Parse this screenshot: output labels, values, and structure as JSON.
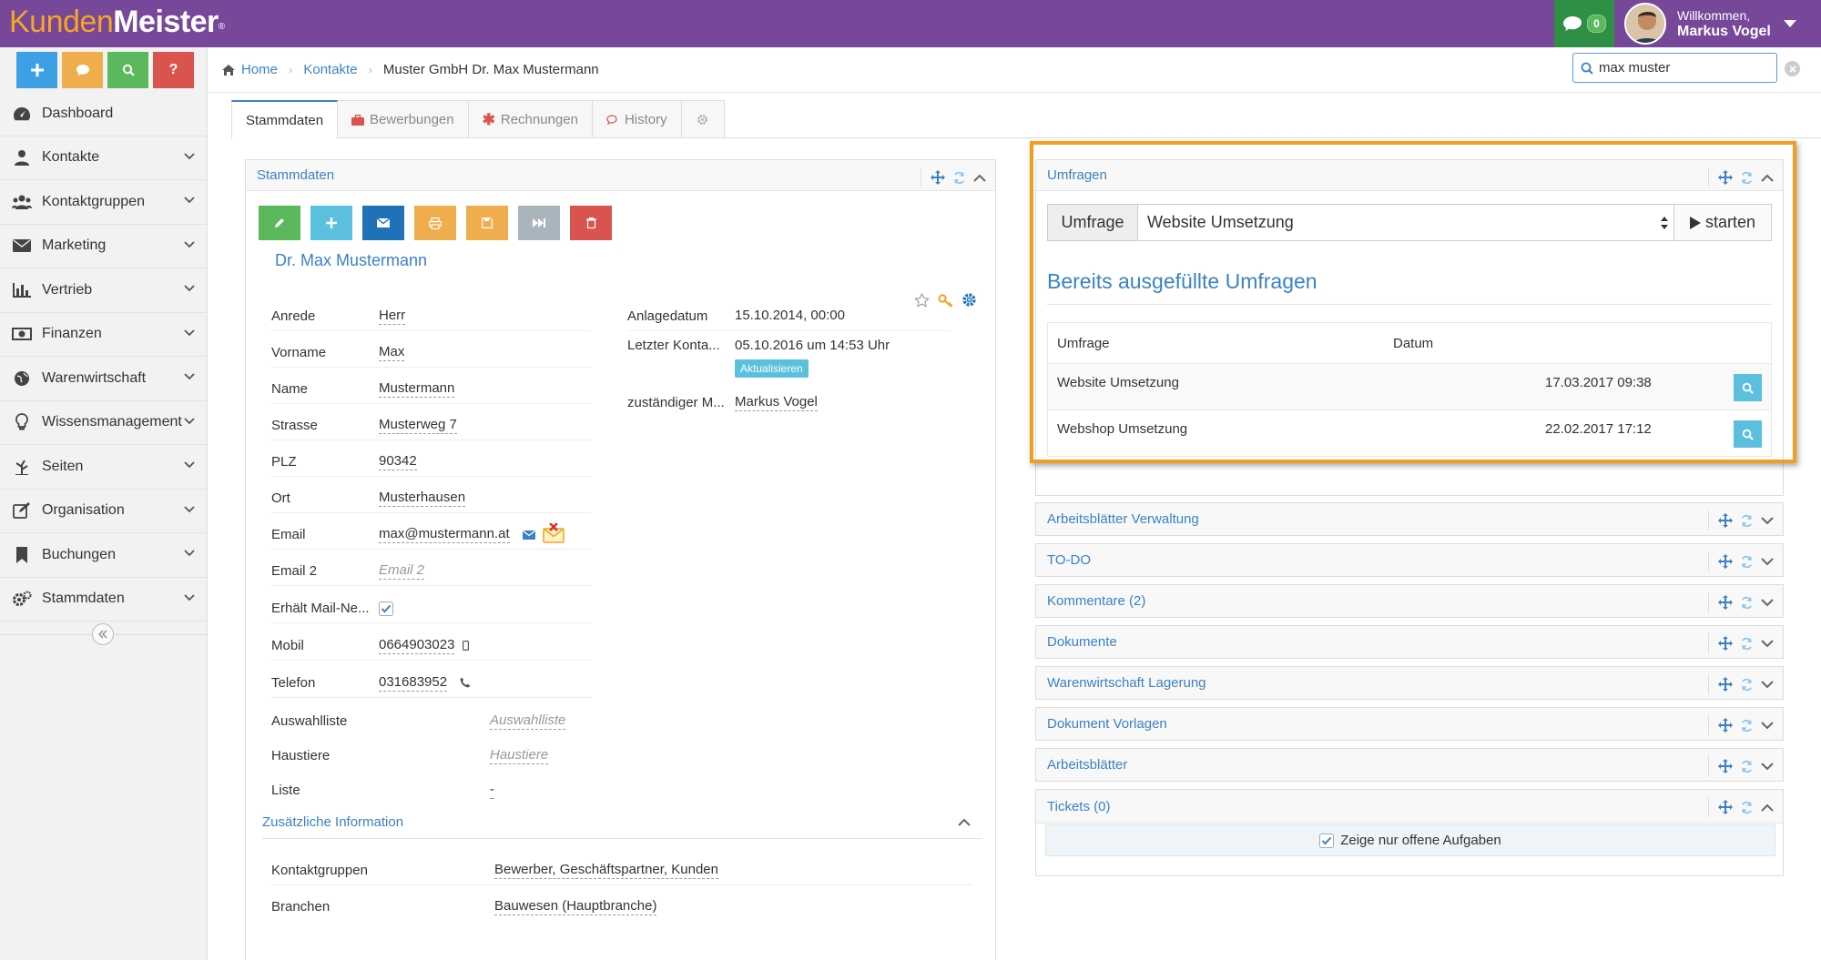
{
  "app": {
    "logo_part1": "Kunden",
    "logo_part2": "Meister",
    "logo_mark": "®",
    "chat_count": "0",
    "user_greeting": "Willkommen,",
    "user_name": "Markus Vogel"
  },
  "quick_buttons": [
    {
      "icon": "plus-icon",
      "color": "#3ea0e4"
    },
    {
      "icon": "chat-icon",
      "color": "#f0ad4e"
    },
    {
      "icon": "search-icon",
      "color": "#5cb85c"
    },
    {
      "icon": "help-icon",
      "color": "#d9534f",
      "label": "?"
    }
  ],
  "sidebar": {
    "items": [
      {
        "label": "Dashboard",
        "icon": "dashboard-icon"
      },
      {
        "label": "Kontakte",
        "icon": "user-icon"
      },
      {
        "label": "Kontaktgruppen",
        "icon": "users-icon"
      },
      {
        "label": "Marketing",
        "icon": "envelope-icon"
      },
      {
        "label": "Vertrieb",
        "icon": "bar-chart-icon"
      },
      {
        "label": "Finanzen",
        "icon": "money-icon"
      },
      {
        "label": "Warenwirtschaft",
        "icon": "globe-icon"
      },
      {
        "label": "Wissensmanagement",
        "icon": "lightbulb-icon"
      },
      {
        "label": "Seiten",
        "icon": "tree-icon"
      },
      {
        "label": "Organisation",
        "icon": "edit-icon"
      },
      {
        "label": "Buchungen",
        "icon": "bookmark-icon"
      },
      {
        "label": "Stammdaten",
        "icon": "gears-icon"
      }
    ]
  },
  "breadcrumb": {
    "home": "Home",
    "contacts": "Kontakte",
    "current": "Muster GmbH Dr. Max Mustermann"
  },
  "search": {
    "value": "max muster"
  },
  "tabs": [
    {
      "label": "Stammdaten",
      "active": true
    },
    {
      "label": "Bewerbungen",
      "icon": "briefcase-icon",
      "color": "#d9534f"
    },
    {
      "label": "Rechnungen",
      "icon": "asterisk-icon",
      "color": "#d9534f"
    },
    {
      "label": "History",
      "icon": "comments-icon",
      "color": "#d9534f"
    },
    {
      "label": "",
      "icon": "gear-icon"
    }
  ],
  "stammdaten": {
    "title": "Stammdaten",
    "action_buttons": [
      {
        "name": "edit-button",
        "icon": "pencil-icon",
        "color": "#5cb85c"
      },
      {
        "name": "add-button",
        "icon": "plus-icon",
        "color": "#5bc0de"
      },
      {
        "name": "email-button",
        "icon": "envelope-icon",
        "color": "#1f72b8"
      },
      {
        "name": "print-button",
        "icon": "print-icon",
        "color": "#f0ad4e"
      },
      {
        "name": "save-button",
        "icon": "save-icon",
        "color": "#f0ad4e"
      },
      {
        "name": "next-button",
        "icon": "fast-forward-icon",
        "color": "#aab4bd"
      },
      {
        "name": "delete-button",
        "icon": "trash-icon",
        "color": "#d9534f"
      }
    ],
    "person": "Dr. Max Mustermann",
    "fields": [
      {
        "label": "Anrede",
        "value": "Herr"
      },
      {
        "label": "Vorname",
        "value": "Max"
      },
      {
        "label": "Name",
        "value": "Mustermann"
      },
      {
        "label": "Strasse",
        "value": "Musterweg 7"
      },
      {
        "label": "PLZ",
        "value": "90342"
      },
      {
        "label": "Ort",
        "value": "Musterhausen"
      },
      {
        "label": "Email",
        "value": "max@mustermann.at"
      },
      {
        "label": "Email 2",
        "value": "Email 2",
        "placeholder": true
      },
      {
        "label": "Erhält Mail-Ne...",
        "checked": true
      },
      {
        "label": "Mobil",
        "value": "0664903023"
      },
      {
        "label": "Telefon",
        "value": "031683952"
      },
      {
        "label": "Auswahlliste",
        "value": "Auswahlliste",
        "placeholder": true
      },
      {
        "label": "Haustiere",
        "value": "Haustiere",
        "placeholder": true
      },
      {
        "label": "Liste",
        "value": "-"
      }
    ],
    "right_fields": [
      {
        "label": "Anlagedatum",
        "value": "15.10.2014, 00:00"
      },
      {
        "label": "Letzter Konta...",
        "value": "05.10.2016 um 14:53 Uhr",
        "action": "Aktualisieren"
      },
      {
        "label": "zuständiger M...",
        "value": "Markus Vogel"
      }
    ],
    "extra_section": "Zusätzliche Information",
    "extra_fields": [
      {
        "label": "Kontaktgruppen",
        "value": "Bewerber, Geschäftspartner, Kunden"
      },
      {
        "label": "Branchen",
        "value": "Bauwesen (Hauptbranche)"
      }
    ]
  },
  "umfragen": {
    "title": "Umfragen",
    "form_label": "Umfrage",
    "selected": "Website Umsetzung",
    "start_label": "starten",
    "heading": "Bereits ausgefüllte Umfragen",
    "columns": [
      "Umfrage",
      "Datum"
    ],
    "rows": [
      {
        "name": "Website Umsetzung",
        "date": "17.03.2017 09:38"
      },
      {
        "name": "Webshop Umsetzung",
        "date": "22.02.2017 17:12"
      }
    ]
  },
  "collapsed_panels": [
    {
      "title": "Arbeitsblätter Verwaltung"
    },
    {
      "title": "TO-DO"
    },
    {
      "title": "Kommentare (2)"
    },
    {
      "title": "Dokumente"
    },
    {
      "title": "Warenwirtschaft Lagerung"
    },
    {
      "title": "Dokument Vorlagen"
    },
    {
      "title": "Arbeitsblätter"
    }
  ],
  "tickets": {
    "title": "Tickets (0)",
    "filter_label": "Zeige nur offene Aufgaben",
    "checked": true
  },
  "colors": {
    "header_bg": "#77489a",
    "accent": "#3b82c4",
    "highlight": "#f29d1f"
  }
}
